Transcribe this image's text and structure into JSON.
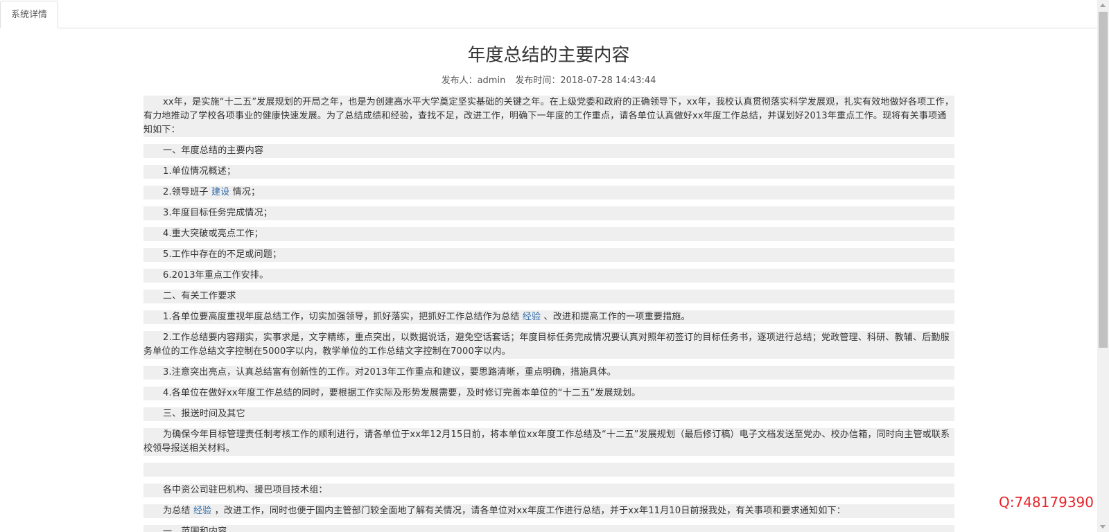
{
  "tabs": [
    {
      "label": "系统详情"
    }
  ],
  "article": {
    "title": "年度总结的主要内容",
    "publisher_label": "发布人：admin",
    "time_label": "发布时间：2018-07-28 14:43:44"
  },
  "paragraphs": {
    "p0": "xx年，是实施“十二五”发展规划的开局之年，也是为创建高水平大学奠定坚实基础的关键之年。在上级党委和政府的正确领导下，xx年，我校认真贯彻落实科学发展观，扎实有效地做好各项工作，有力地推动了学校各项事业的健康快速发展。为了总结成绩和经验，查找不足，改进工作，明确下一年度的工作重点，请各单位认真做好xx年度工作总结，并谋划好2013年重点工作。现将有关事项通知如下：",
    "p1": "一、年度总结的主要内容",
    "p2": "1.单位情况概述；",
    "p3_a": "2.领导班子 ",
    "p3_link": "建设",
    "p3_b": " 情况；",
    "p4": "3.年度目标任务完成情况；",
    "p5": "4.重大突破或亮点工作；",
    "p6": "5.工作中存在的不足或问题；",
    "p7": "6.2013年重点工作安排。",
    "p8": "二、有关工作要求",
    "p9_a": "1.各单位要高度重视年度总结工作，切实加强领导，抓好落实，把抓好工作总结作为总结 ",
    "p9_link": "经验",
    "p9_b": " 、改进和提高工作的一项重要措施。",
    "p10": "2.工作总结要内容翔实，实事求是，文字精练，重点突出，以数据说话，避免空话套话；年度目标任务完成情况要认真对照年初签订的目标任务书，逐项进行总结；党政管理、科研、教辅、后勤服务单位的工作总结文字控制在5000字以内，教学单位的工作总结文字控制在7000字以内。",
    "p11": "3.注意突出亮点，认真总结富有创新性的工作。对2013年工作重点和建议，要思路清晰，重点明确，措施具体。",
    "p12": "4.各单位在做好xx年度工作总结的同时，要根据工作实际及形势发展需要，及时修订完善本单位的“十二五”发展规划。",
    "p13": "三、报送时间及其它",
    "p14": "为确保今年目标管理责任制考核工作的顺利进行，请各单位于xx年12月15日前，将本单位xx年度工作总结及“十二五”发展规划（最后修订稿）电子文档发送至党办、校办信箱，同时向主管或联系校领导报送相关材料。",
    "p15": "",
    "p16": "各中资公司驻巴机构、援巴项目技术组：",
    "p17_a": "为总结 ",
    "p17_link": "经验",
    "p17_b": " ，改进工作，同时也便于国内主管部门较全面地了解有关情况，请各单位对xx年度工作进行总结，并于xx年11月10日前报我处，有关事项和要求通知如下：",
    "p18": "一、范围和内容"
  },
  "overlay": {
    "qq": "Q:748179390"
  },
  "colors": {
    "paragraph_bg": "#efefef",
    "link": "#2f6aa8",
    "qq_text": "#e8232a"
  }
}
